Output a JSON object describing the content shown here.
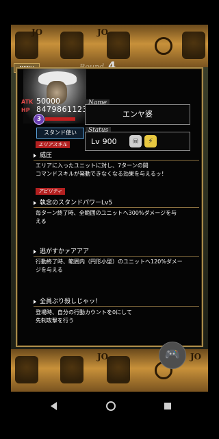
{
  "header": {
    "menu_tab": "MENU",
    "round_label": "Round",
    "round_number": "4",
    "band_marks": [
      "JO",
      "JO",
      "JO",
      "JO"
    ]
  },
  "character": {
    "atk_label": "ATK",
    "atk_value": "50000",
    "hp_label": "HP",
    "hp_value": "8479861123",
    "stock": "3",
    "stand_button": "スタンド使い"
  },
  "name_section": {
    "label": "Name",
    "value": "エンヤ婆"
  },
  "status_section": {
    "label": "Status",
    "level_label": "Lv",
    "level_value": "900",
    "icon_a": "skull-icon",
    "icon_b": "lightning-icon"
  },
  "area_skill": {
    "tag": "エリアスキル",
    "title": "威圧",
    "description_lines": [
      "エリアに入ったユニットに対し、7ターンの間",
      "コマンドスキルが発動できなくなる効果を与えるッ！"
    ]
  },
  "abilities": {
    "tag": "アビリティ",
    "items": [
      {
        "title": "執念のスタンドパワーLv5",
        "lines": [
          "毎ターン終了時、全範囲のユニットへ300%ダメージを与",
          "える"
        ]
      },
      {
        "title": "逃がすかァアアア",
        "lines": [
          "行動終了時、範囲内（円形小型）のユニットへ120%ダメー",
          "ジを与える"
        ]
      },
      {
        "title": "全員ぶり殺しじゃッ！",
        "lines": [
          "登場時、自分の行動カウントを0にして",
          "先制攻撃を行う"
        ]
      }
    ]
  },
  "overlay": {
    "fab_icon": "gamepad-icon"
  },
  "navbar": {
    "back_icon": "back-triangle-icon",
    "home_icon": "home-circle-icon",
    "recent_icon": "recent-square-icon"
  }
}
